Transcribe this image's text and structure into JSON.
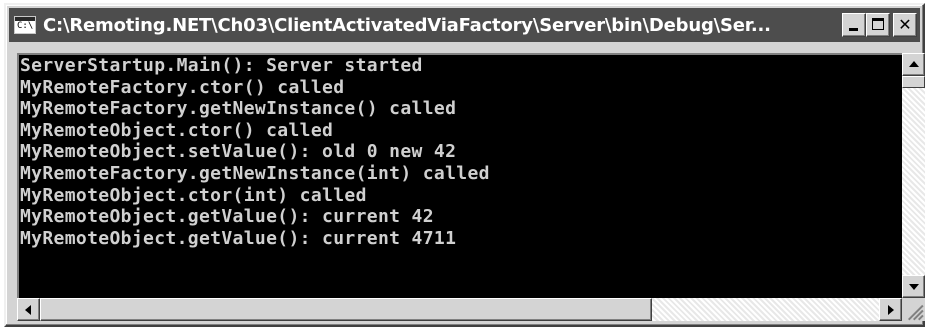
{
  "window": {
    "title": "C:\\Remoting.NET\\Ch03\\ClientActivatedViaFactory\\Server\\bin\\Debug\\Ser...",
    "icon": "console-icon",
    "icon_glyph": "C:\\",
    "buttons": {
      "minimize": "minimize-icon",
      "maximize": "maximize-icon",
      "close": "close-icon",
      "close_glyph": "✕"
    }
  },
  "console": {
    "lines": [
      "ServerStartup.Main(): Server started",
      "MyRemoteFactory.ctor() called",
      "MyRemoteFactory.getNewInstance() called",
      "MyRemoteObject.ctor() called",
      "MyRemoteObject.setValue(): old 0 new 42",
      "MyRemoteFactory.getNewInstance(int) called",
      "MyRemoteObject.ctor(int) called",
      "MyRemoteObject.getValue(): current 42",
      "MyRemoteObject.getValue(): current 4711"
    ]
  },
  "colors": {
    "console_background": "#000000",
    "console_text": "#d0d0d0",
    "titlebar_background": "#4d4d4d",
    "frame": "#d4d4d4"
  }
}
